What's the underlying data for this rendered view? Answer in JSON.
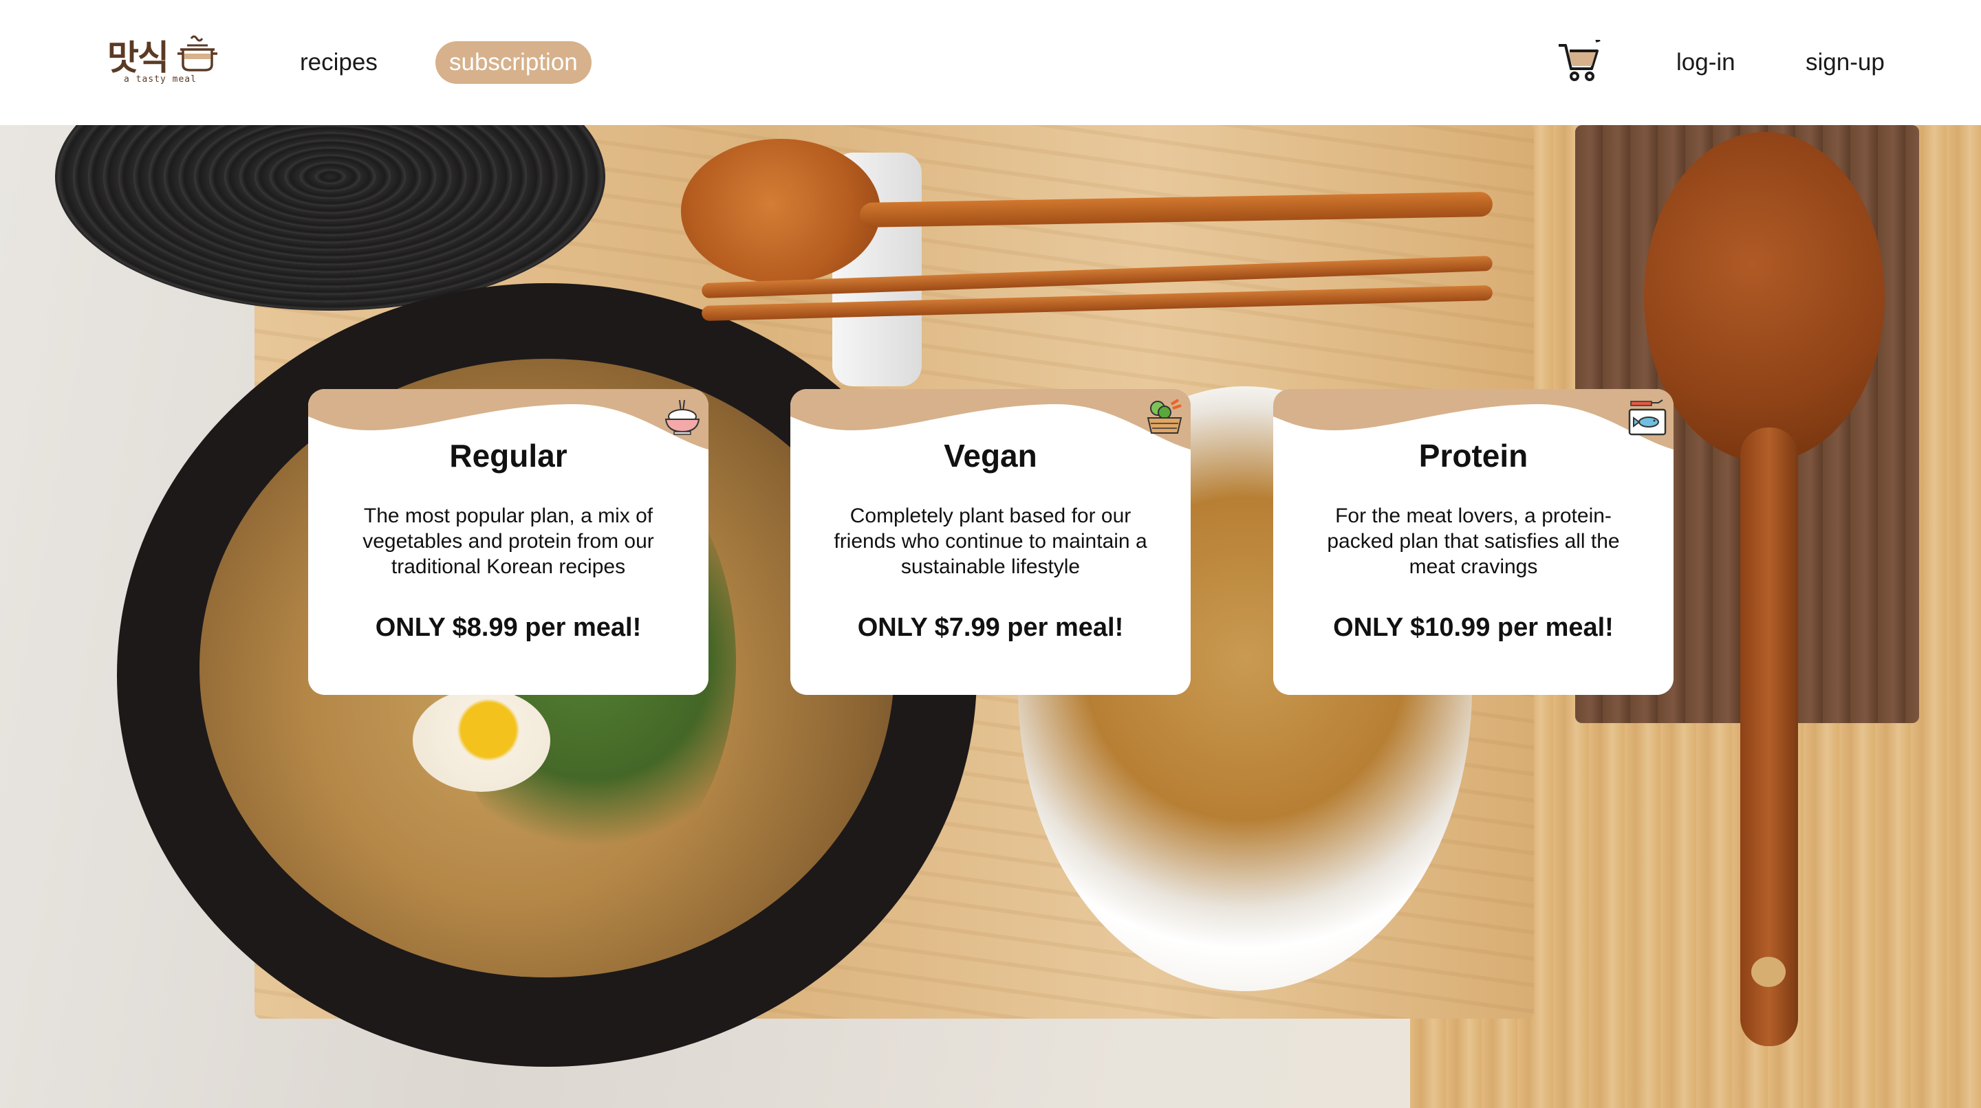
{
  "logo": {
    "hangul": "맛식",
    "tagline": "a tasty meal"
  },
  "nav": {
    "recipes": "recipes",
    "subscription": "subscription",
    "login": "log-in",
    "signup": "sign-up",
    "cart_icon": "shopping-cart-icon"
  },
  "colors": {
    "accent": "#d6b18b",
    "text": "#111111",
    "background": "#ffffff"
  },
  "plans": [
    {
      "title": "Regular",
      "description": "The most popular plan, a mix of vegetables and protein from our traditional Korean recipes",
      "price": "ONLY $8.99 per meal!",
      "icon": "rice-bowl-icon"
    },
    {
      "title": "Vegan",
      "description": "Completely plant based for our friends who continue to maintain a sustainable lifestyle",
      "price": "ONLY $7.99 per meal!",
      "icon": "vegetable-basket-icon"
    },
    {
      "title": "Protein",
      "description": "For the meat lovers, a protein-packed plan that satisfies all the meat cravings",
      "price": "ONLY $10.99 per meal!",
      "icon": "fish-board-icon"
    }
  ]
}
